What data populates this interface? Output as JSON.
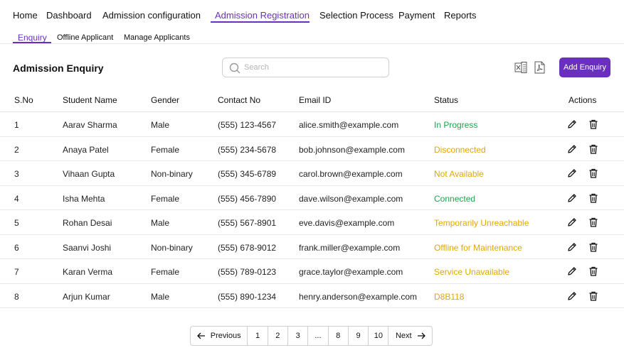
{
  "nav": {
    "items": [
      "Home",
      "Dashboard",
      "Admission configuration",
      "Admission Registration",
      "Selection Process",
      "Payment",
      "Reports"
    ],
    "active_index": 3
  },
  "subnav": {
    "items": [
      "Enquiry",
      "Offline Applicant",
      "Manage Applicants"
    ],
    "active_index": 0
  },
  "page": {
    "title": "Admission Enquiry"
  },
  "search": {
    "placeholder": "Search",
    "value": ""
  },
  "toolbar": {
    "add_label": "Add Enquiry",
    "excel_icon": "excel-export-icon",
    "pdf_icon": "pdf-export-icon"
  },
  "table": {
    "headers": [
      "S.No",
      "Student Name",
      "Gender",
      "Contact No",
      "Email ID",
      "Status",
      "Actions"
    ],
    "rows": [
      {
        "sno": "1",
        "name": "Aarav Sharma",
        "gender": "Male",
        "contact": "(555) 123-4567",
        "email": "alice.smith@example.com",
        "status": "In Progress",
        "status_kind": "green"
      },
      {
        "sno": "2",
        "name": "Anaya Patel",
        "gender": "Female",
        "contact": "(555) 234-5678",
        "email": "bob.johnson@example.com",
        "status": "Disconnected",
        "status_kind": "amber"
      },
      {
        "sno": "3",
        "name": "Vihaan Gupta",
        "gender": "Non-binary",
        "contact": "(555) 345-6789",
        "email": "carol.brown@example.com",
        "status": "Not Available",
        "status_kind": "amber"
      },
      {
        "sno": "4",
        "name": "Isha Mehta",
        "gender": "Female",
        "contact": "(555) 456-7890",
        "email": "dave.wilson@example.com",
        "status": "Connected",
        "status_kind": "green"
      },
      {
        "sno": "5",
        "name": "Rohan Desai",
        "gender": "Male",
        "contact": "(555) 567-8901",
        "email": "eve.davis@example.com",
        "status": "Temporarily Unreachable",
        "status_kind": "amber"
      },
      {
        "sno": "6",
        "name": "Saanvi Joshi",
        "gender": "Non-binary",
        "contact": "(555) 678-9012",
        "email": "frank.miller@example.com",
        "status": "Offline for Maintenance",
        "status_kind": "amber"
      },
      {
        "sno": "7",
        "name": "Karan Verma",
        "gender": "Female",
        "contact": "(555) 789-0123",
        "email": "grace.taylor@example.com",
        "status": "Service Unavailable",
        "status_kind": "amber"
      },
      {
        "sno": "8",
        "name": "Arjun Kumar",
        "gender": "Male",
        "contact": "(555) 890-1234",
        "email": "henry.anderson@example.com",
        "status": "D8B118",
        "status_kind": "amber"
      }
    ]
  },
  "pagination": {
    "prev_label": "Previous",
    "next_label": "Next",
    "pages": [
      "1",
      "2",
      "3",
      "...",
      "8",
      "9",
      "10"
    ]
  },
  "colors": {
    "accent": "#6a2fbf",
    "status_green": "#1fa34a",
    "status_amber": "#e0a800"
  }
}
